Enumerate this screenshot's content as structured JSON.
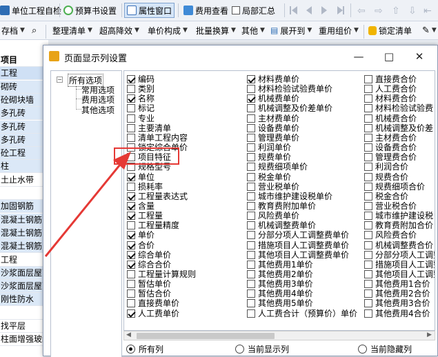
{
  "toolbar1": {
    "items": [
      "单位工程自检",
      "预算书设置",
      "属性窗口",
      "费用查看",
      "局部汇总"
    ]
  },
  "toolbar2": {
    "items": [
      "存档",
      "整理清单",
      "超高降效",
      "单价构成",
      "批量换算",
      "其他",
      "展开到",
      "重用组价",
      "锁定清单"
    ]
  },
  "background_rows": [
    "项目",
    "工程",
    "砌砖",
    "砼砌块墙",
    "多孔砖",
    "多孔砖",
    "多孔砖",
    "砼工程",
    "柱",
    "土止水带",
    "",
    "加固钢筋",
    "混凝土钢筋",
    "混凝土钢筋",
    "混凝土钢筋",
    "工程",
    "沙浆面层屋面",
    "沙浆面层屋面",
    "刚性防水",
    "",
    "找平层",
    "柱面增强玻纤"
  ],
  "dialog": {
    "title": "页面显示列设置",
    "minimize": "—",
    "maximize": "□",
    "close": "✕",
    "tree": {
      "root": "所有选项",
      "children": [
        "常用选项",
        "费用选项",
        "其他选项"
      ]
    },
    "columns": [
      [
        {
          "label": "编码",
          "checked": true
        },
        {
          "label": "类别",
          "checked": false
        },
        {
          "label": "名称",
          "checked": true
        },
        {
          "label": "标记",
          "checked": false
        },
        {
          "label": "专业",
          "checked": false
        },
        {
          "label": "主要清单",
          "checked": false
        },
        {
          "label": "清单工程内容",
          "checked": false
        },
        {
          "label": "锁定综合单价",
          "checked": false
        },
        {
          "label": "项目特征",
          "checked": false
        },
        {
          "label": "规格型号",
          "checked": false
        },
        {
          "label": "单位",
          "checked": true
        },
        {
          "label": "损耗率",
          "checked": false
        },
        {
          "label": "工程量表达式",
          "checked": true
        },
        {
          "label": "含量",
          "checked": true
        },
        {
          "label": "工程量",
          "checked": true
        },
        {
          "label": "工程量精度",
          "checked": false
        },
        {
          "label": "单价",
          "checked": true
        },
        {
          "label": "合价",
          "checked": true
        },
        {
          "label": "综合单价",
          "checked": true
        },
        {
          "label": "综合合价",
          "checked": true
        },
        {
          "label": "工程量计算规则",
          "checked": false
        },
        {
          "label": "暂估单价",
          "checked": false
        },
        {
          "label": "暂估合价",
          "checked": false
        },
        {
          "label": "直接费单价",
          "checked": false
        },
        {
          "label": "人工费单价",
          "checked": true
        }
      ],
      [
        {
          "label": "材料费单价",
          "checked": true
        },
        {
          "label": "材料检验试验费单价",
          "checked": false
        },
        {
          "label": "机械费单价",
          "checked": true
        },
        {
          "label": "机械调整及价差单价",
          "checked": false
        },
        {
          "label": "主材费单价",
          "checked": false
        },
        {
          "label": "设备费单价",
          "checked": false
        },
        {
          "label": "管理费单价",
          "checked": false
        },
        {
          "label": "利润单价",
          "checked": false
        },
        {
          "label": "规费单价",
          "checked": false
        },
        {
          "label": "规费细项单价",
          "checked": false
        },
        {
          "label": "税金单价",
          "checked": false
        },
        {
          "label": "营业税单价",
          "checked": false
        },
        {
          "label": "城市维护建设税单价",
          "checked": false
        },
        {
          "label": "教育费附加单价",
          "checked": false
        },
        {
          "label": "风险费单价",
          "checked": false
        },
        {
          "label": "机械调整费单价",
          "checked": false
        },
        {
          "label": "分部分项人工调整费单价",
          "checked": false
        },
        {
          "label": "措施项目人工调整费单价",
          "checked": false
        },
        {
          "label": "其他项目人工调整费单价",
          "checked": false
        },
        {
          "label": "其他费用1单价",
          "checked": false
        },
        {
          "label": "其他费用2单价",
          "checked": false
        },
        {
          "label": "其他费用3单价",
          "checked": false
        },
        {
          "label": "其他费用4单价",
          "checked": false
        },
        {
          "label": "其他费用5单价",
          "checked": false
        },
        {
          "label": "人工费合计（预算价）单价",
          "checked": false
        }
      ],
      [
        {
          "label": "直接费合价",
          "checked": false
        },
        {
          "label": "人工费合价",
          "checked": false
        },
        {
          "label": "材料费合价",
          "checked": false
        },
        {
          "label": "材料检验试验费",
          "checked": false
        },
        {
          "label": "机械费合价",
          "checked": false
        },
        {
          "label": "机械调整及价差",
          "checked": false
        },
        {
          "label": "主材费合价",
          "checked": false
        },
        {
          "label": "设备费合价",
          "checked": false
        },
        {
          "label": "管理费合价",
          "checked": false
        },
        {
          "label": "利润合价",
          "checked": false
        },
        {
          "label": "规费合价",
          "checked": false
        },
        {
          "label": "规费细项合价",
          "checked": false
        },
        {
          "label": "税金合价",
          "checked": false
        },
        {
          "label": "营业税合价",
          "checked": false
        },
        {
          "label": "城市维护建设税",
          "checked": false
        },
        {
          "label": "教育费附加合价",
          "checked": false
        },
        {
          "label": "风险费合价",
          "checked": false
        },
        {
          "label": "机械调整费合价",
          "checked": false
        },
        {
          "label": "分部分项人工调整",
          "checked": false
        },
        {
          "label": "措施项目人工调整",
          "checked": false
        },
        {
          "label": "其他项目人工调整",
          "checked": false
        },
        {
          "label": "其他费用1合价",
          "checked": false
        },
        {
          "label": "其他费用2合价",
          "checked": false
        },
        {
          "label": "其他费用3合价",
          "checked": false
        },
        {
          "label": "其他费用4合价",
          "checked": false
        }
      ]
    ],
    "radios": [
      {
        "label": "所有列",
        "selected": true
      },
      {
        "label": "当前显示列",
        "selected": false
      },
      {
        "label": "当前隐藏列",
        "selected": false
      }
    ]
  },
  "colors": {
    "highlight": "#e53935",
    "accent": "#cfe0f5"
  }
}
